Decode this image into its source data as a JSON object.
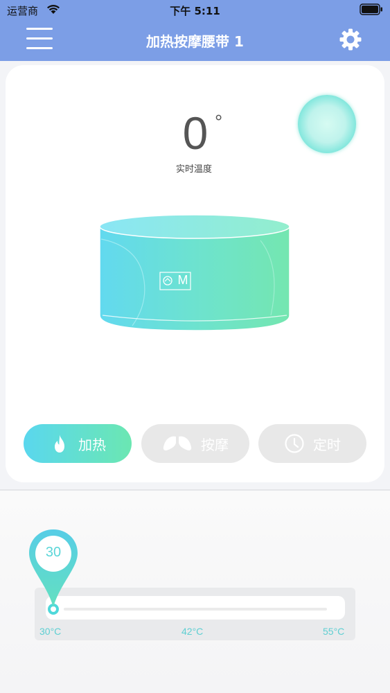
{
  "status_bar": {
    "carrier": "运营商",
    "time": "下午 5:11"
  },
  "nav": {
    "title": "加热按摩腰带 1",
    "menu_icon": "hamburger-menu-icon",
    "settings_icon": "gear-icon"
  },
  "temperature": {
    "value": "0",
    "degree_symbol": "°",
    "label": "实时温度"
  },
  "belt": {
    "logo_text": "M"
  },
  "modes": [
    {
      "label": "加热",
      "icon": "flame-icon",
      "active": true
    },
    {
      "label": "按摩",
      "icon": "lungs-icon",
      "active": false
    },
    {
      "label": "定时",
      "icon": "clock-icon",
      "active": false
    }
  ],
  "slider": {
    "current": "30",
    "ticks": [
      "30°C",
      "42°C",
      "55°C"
    ],
    "min": 30,
    "max": 55,
    "position_fraction": 0.0
  },
  "colors": {
    "nav_bg": "#7c9ee6",
    "accent_teal": "#5bd6d8",
    "heat_gradient_start": "#5ad7ee",
    "heat_gradient_end": "#6be7b2",
    "inactive_button": "#e8e8e8"
  }
}
